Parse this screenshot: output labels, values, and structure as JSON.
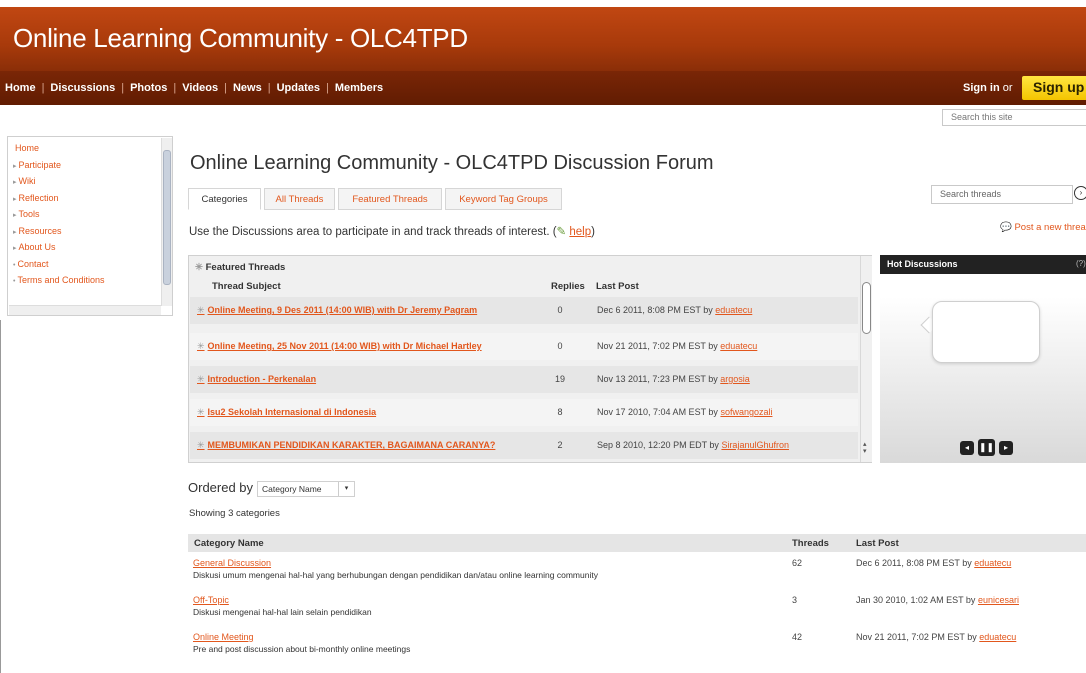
{
  "header": {
    "site_title": "Online Learning Community - OLC4TPD",
    "nav": [
      "Home",
      "Discussions",
      "Photos",
      "Videos",
      "News",
      "Updates",
      "Members"
    ],
    "sign_in": "Sign in",
    "or": "or",
    "sign_up": "Sign up",
    "site_search_placeholder": "Search this site"
  },
  "sidebar": {
    "items": [
      {
        "label": "Home",
        "marker": ""
      },
      {
        "label": "Participate",
        "marker": "▸"
      },
      {
        "label": "Wiki",
        "marker": "▸"
      },
      {
        "label": "Reflection",
        "marker": "▸"
      },
      {
        "label": "Tools",
        "marker": "▸"
      },
      {
        "label": "Resources",
        "marker": "▸"
      },
      {
        "label": "About Us",
        "marker": "▸"
      },
      {
        "label": "Contact",
        "marker": "•"
      },
      {
        "label": "Terms and Conditions",
        "marker": "•"
      }
    ]
  },
  "forum": {
    "title": "Online Learning Community - OLC4TPD Discussion Forum",
    "tabs": [
      "Categories",
      "All Threads",
      "Featured Threads",
      "Keyword Tag Groups"
    ],
    "thread_search_placeholder": "Search threads",
    "intro_text": "Use the Discussions area to participate in and track threads of interest. (",
    "help_link": "help",
    "intro_close": ")",
    "post_new": "Post a new threa"
  },
  "featured": {
    "title": "Featured Threads",
    "columns": {
      "subject": "Thread Subject",
      "replies": "Replies",
      "last_post": "Last Post"
    },
    "threads": [
      {
        "subject": "Online Meeting, 9 Des 2011 (14:00 WIB) with Dr Jeremy Pagram",
        "replies": "0",
        "last_post": "Dec 6 2011, 8:08 PM EST by",
        "author": "eduatecu"
      },
      {
        "subject": "Online Meeting, 25 Nov 2011 (14:00 WIB) with Dr Michael Hartley",
        "replies": "0",
        "last_post": "Nov 21 2011, 7:02 PM EST by",
        "author": "eduatecu"
      },
      {
        "subject": "Introduction - Perkenalan",
        "replies": "19",
        "last_post": "Nov 13 2011, 7:23 PM EST by",
        "author": "argosia"
      },
      {
        "subject": "Isu2 Sekolah Internasional di Indonesia",
        "replies": "8",
        "last_post": "Nov 17 2010, 7:04 AM EST by",
        "author": "sofwangozali"
      },
      {
        "subject": "MEMBUMIKAN PENDIDIKAN KARAKTER, BAGAIMANA CARANYA?",
        "replies": "2",
        "last_post": "Sep 8 2010, 12:20 PM EDT by",
        "author": "SirajanulGhufron"
      }
    ]
  },
  "hot": {
    "title": "Hot Discussions",
    "help": "(?)"
  },
  "ordering": {
    "label": "Ordered by",
    "selected": "Category Name",
    "showing": "Showing 3 categories"
  },
  "categories": {
    "columns": {
      "name": "Category Name",
      "threads": "Threads",
      "last_post": "Last Post"
    },
    "rows": [
      {
        "name": "General Discussion",
        "description": "Diskusi umum mengenai hal-hal yang berhubungan dengan pendidikan dan/atau online learning community",
        "threads": "62",
        "last_post": "Dec 6 2011, 8:08 PM EST by",
        "author": "eduatecu"
      },
      {
        "name": "Off-Topic",
        "description": "Diskusi mengenai hal-hal lain selain pendidikan",
        "threads": "3",
        "last_post": "Jan 30 2010, 1:02 AM EST by",
        "author": "eunicesari"
      },
      {
        "name": "Online Meeting",
        "description": "Pre and post discussion about bi-monthly online meetings",
        "threads": "42",
        "last_post": "Nov 21 2011, 7:02 PM EST by",
        "author": "eduatecu"
      }
    ]
  },
  "colors": {
    "accent": "#e2571d",
    "header": "#a83a0b",
    "nav": "#611c02",
    "signup": "#f4c400"
  }
}
